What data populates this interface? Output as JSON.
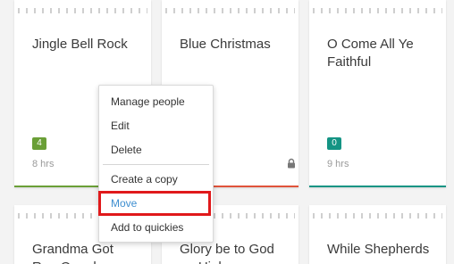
{
  "cards": [
    {
      "title": "Jingle Bell Rock",
      "badge": "4",
      "badge_color": "#6a9f37",
      "hours": "8 hrs",
      "accent": "#6a9f37"
    },
    {
      "title": "Blue Christmas",
      "locked": true,
      "accent": "#e0533a"
    },
    {
      "title": "O Come All Ye Faithful",
      "badge": "0",
      "badge_color": "#149484",
      "hours": "9 hrs",
      "accent": "#149484"
    },
    {
      "title": "Grandma Got Run Over by"
    },
    {
      "title": "Glory be to God on High"
    },
    {
      "title": "While Shepherds"
    }
  ],
  "context_menu": {
    "items": [
      "Manage people",
      "Edit",
      "Delete",
      "Create a copy",
      "Move",
      "Add to quickies"
    ],
    "active_item": "Move",
    "highlight_color": "#e0191b"
  }
}
